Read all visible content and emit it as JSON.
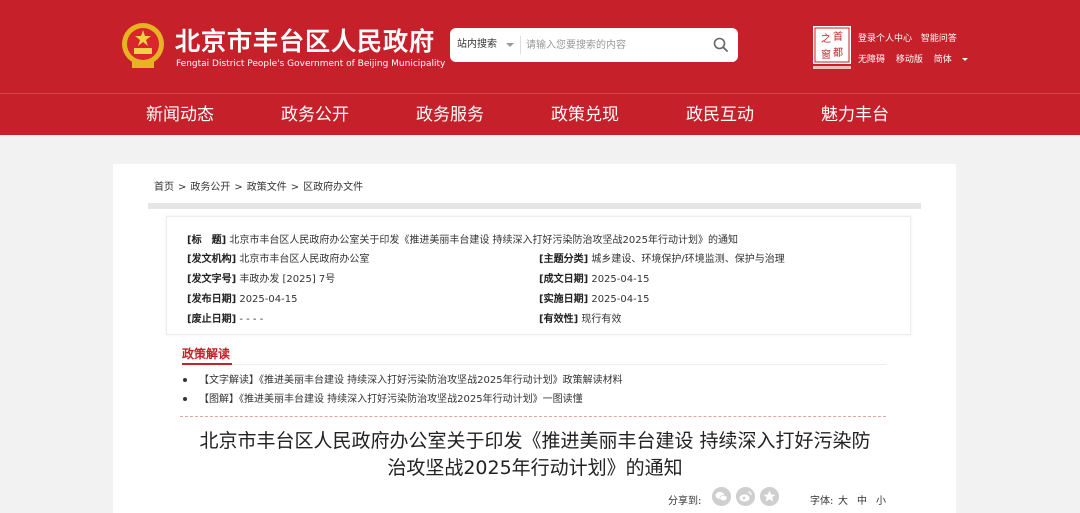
{
  "header": {
    "title": "北京市丰台区人民政府",
    "subtitle": "Fengtai District People's Government of Beijing Municipality",
    "search": {
      "scope": "站内搜索",
      "placeholder": "请输入您要搜索的内容"
    },
    "top_links": [
      "登录个人中心",
      "智能问答"
    ],
    "top_links2": [
      "无障碍",
      "移动版",
      "简体"
    ],
    "capital_logo_text": [
      "之",
      "首",
      "都",
      "窗"
    ]
  },
  "nav": [
    "新闻动态",
    "政务公开",
    "政务服务",
    "政策兑现",
    "政民互动",
    "魅力丰台"
  ],
  "breadcrumb": [
    "首页",
    "政务公开",
    "政策文件",
    "区政府办文件"
  ],
  "info": {
    "title_label": "[标　题]",
    "title_value": "北京市丰台区人民政府办公室关于印发《推进美丽丰台建设 持续深入打好污染防治攻坚战2025年行动计划》的通知",
    "issuer_label": "[发文机构]",
    "issuer_value": "北京市丰台区人民政府办公室",
    "topic_label": "[主题分类]",
    "topic_value": "城乡建设、环境保护/环境监测、保护与治理",
    "docno_label": "[发文字号]",
    "docno_value": "丰政办发 [2025] 7号",
    "created_label": "[成文日期]",
    "created_value": "2025-04-15",
    "published_label": "[发布日期]",
    "published_value": "2025-04-15",
    "effective_label": "[实施日期]",
    "effective_value": "2025-04-15",
    "expiry_label": "[废止日期]",
    "expiry_value": "- - - -",
    "validity_label": "[有效性]",
    "validity_value": "现行有效"
  },
  "interpretation": {
    "heading": "政策解读",
    "items": [
      "【文字解读】《推进美丽丰台建设 持续深入打好污染防治攻坚战2025年行动计划》政策解读材料",
      "【图解】《推进美丽丰台建设 持续深入打好污染防治攻坚战2025年行动计划》一图读懂"
    ]
  },
  "document": {
    "title_line1": "北京市丰台区人民政府办公室关于印发《推进美丽丰台建设 持续深入打好污染防",
    "title_line2": "治攻坚战2025年行动计划》的通知"
  },
  "share": {
    "label": "分享到:",
    "icons": [
      "wechat-icon",
      "weibo-icon",
      "qzone-icon"
    ]
  },
  "font_size": {
    "label": "字体:",
    "options": [
      "大",
      "中",
      "小"
    ]
  },
  "colors": {
    "brand_red": "#c6202a",
    "background": "#f2f2f2"
  }
}
